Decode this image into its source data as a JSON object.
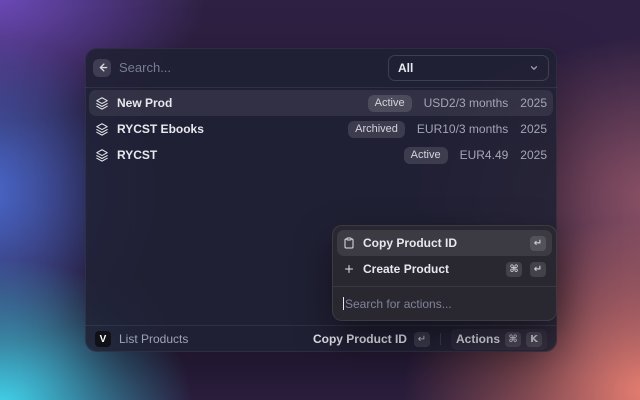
{
  "window": {
    "search": {
      "placeholder": "Search..."
    },
    "filter_dropdown": {
      "value": "All"
    },
    "products": [
      {
        "title": "New Prod",
        "status": "Active",
        "price": "USD2/3 months",
        "year": "2025"
      },
      {
        "title": "RYCST Ebooks",
        "status": "Archived",
        "price": "EUR10/3 months",
        "year": "2025"
      },
      {
        "title": "RYCST",
        "status": "Active",
        "price": "EUR4.49",
        "year": "2025"
      }
    ],
    "actions_popup": {
      "items": [
        {
          "label": "Copy Product ID",
          "keys": [
            "↵"
          ]
        },
        {
          "label": "Create Product",
          "keys": [
            "⌘",
            "↵"
          ]
        }
      ],
      "search_placeholder": "Search for actions..."
    },
    "footer": {
      "logo_glyph": "V",
      "source_label": "List Products",
      "primary_action": {
        "label": "Copy Product ID",
        "key": "↵"
      },
      "actions_button": {
        "label": "Actions",
        "keys": [
          "⌘",
          "K"
        ]
      }
    }
  },
  "colors": {
    "selected_row_bg": "rgba(255,255,255,0.08)",
    "badge_bg": "rgba(255,255,255,0.13)",
    "window_bg": "rgba(30,32,50,0.84)",
    "gradient_palette": [
      "#6f4cc0",
      "#2e2042",
      "#4a6cd4",
      "#41d6ee",
      "#ea8071",
      "#8f5366"
    ]
  }
}
